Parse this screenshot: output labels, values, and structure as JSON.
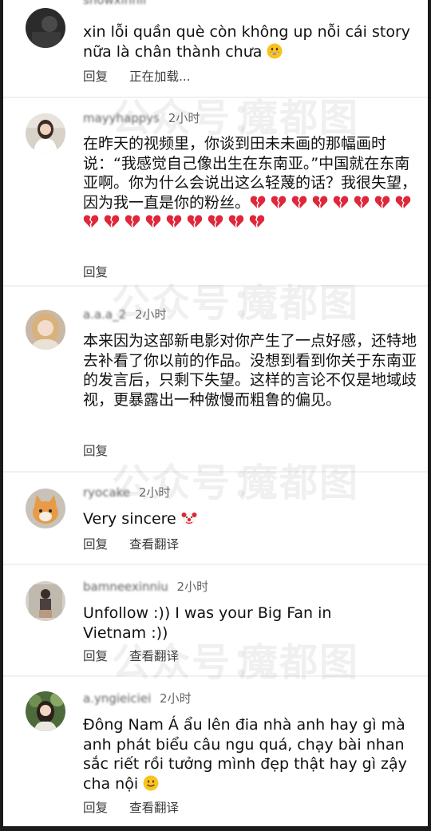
{
  "comments": [
    {
      "username": "showxinnii",
      "time": "",
      "text": "xin lỗi quần què còn không up nỗi cái story nữa là chân thành chưa",
      "actions": [
        "回复",
        "正在加载..."
      ],
      "avatar_icon": "avatar-dark-icon"
    },
    {
      "username": "mayyhappys",
      "time": "2小时",
      "text": "在昨天的视频里，你谈到田未未画的那幅画时说：“我感觉自己像出生在东南亚。”中国就在东南亚啊。你为什么会说出这么轻蔑的话？我很失望，因为我一直是你的粉丝。",
      "actions": [
        "回复"
      ],
      "avatar_icon": "avatar-girl-white-top-icon",
      "broken_heart_count": 17
    },
    {
      "username": "a.a.a_2",
      "time": "2小时",
      "text": "本来因为这部新电影对你产生了一点好感，还特地去补看了你以前的作品。没想到看到你关于东南亚的发言后，只剩下失望。这样的言论不仅是地域歧视，更暴露出一种傲慢而粗鲁的偏见。",
      "actions": [
        "回复"
      ],
      "avatar_icon": "avatar-girl-blonde-icon"
    },
    {
      "username": "ryocake",
      "time": "2小时",
      "text": "Very sincere",
      "actions": [
        "回复",
        "查看翻译"
      ],
      "avatar_icon": "avatar-cat-icon"
    },
    {
      "username": "bamneexinniu",
      "time": "2小时",
      "text": "Unfollow :)) I was your Big Fan in Vietnam :))",
      "actions": [
        "回复",
        "查看翻译"
      ],
      "avatar_icon": "avatar-mirror-selfie-icon"
    },
    {
      "username": "a.yngieiciei",
      "time": "2小时",
      "text": "Đông Nam Á ẩu lên đia nhà anh hay gì mà anh phát biểu câu ngu quá, chạy bài nhan sắc riết rồi tưởng mình đẹp thật hay gì zậy cha nội",
      "actions": [
        "回复",
        "查看翻译"
      ],
      "avatar_icon": "avatar-girl-garden-icon"
    }
  ],
  "watermark": {
    "left_text": "公众号：",
    "right_text": "魔都图"
  },
  "colors": {
    "broken_heart": "#e0263a",
    "watermark": "#969696"
  }
}
